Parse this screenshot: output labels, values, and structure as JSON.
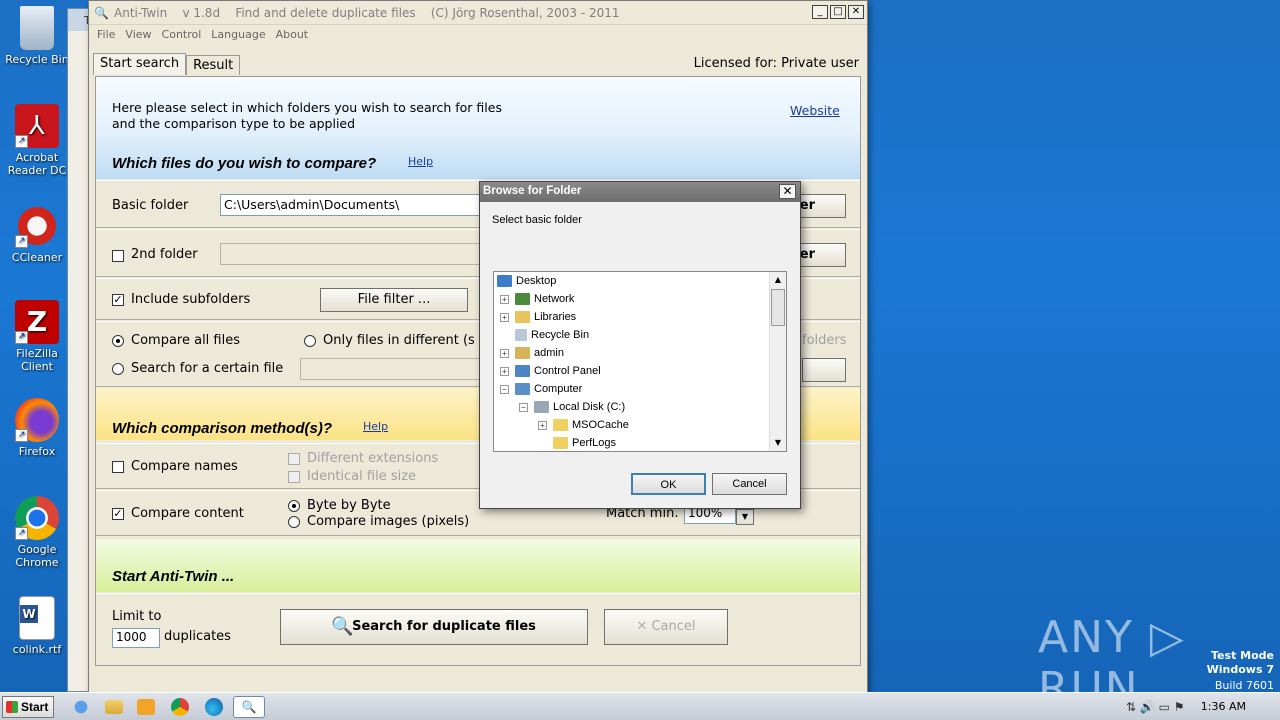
{
  "desktop": {
    "icons": [
      {
        "label": "Recycle Bin",
        "icon": "recycle-bin-icon"
      },
      {
        "label": "Acrobat Reader DC",
        "icon": "acrobat-icon"
      },
      {
        "label": "CCleaner",
        "icon": "ccleaner-icon"
      },
      {
        "label": "FileZilla Client",
        "icon": "filezilla-icon"
      },
      {
        "label": "Firefox",
        "icon": "firefox-icon"
      },
      {
        "label": "Google Chrome",
        "icon": "chrome-icon"
      },
      {
        "label": "colink.rtf",
        "icon": "word-document-icon"
      }
    ],
    "watermark": "ANY ▷ RUN",
    "test_mode": {
      "line1": "Test Mode",
      "line2": "Windows 7",
      "line3": "Build 7601"
    },
    "bg_window_title": "Ti"
  },
  "app": {
    "title": "Anti-Twin    v 1.8d    Find and delete duplicate files    (C) Jörg Rosenthal, 2003 - 2011",
    "menu": [
      "File",
      "View",
      "Control",
      "Language",
      "About"
    ],
    "tabs": [
      {
        "label": "Start search"
      },
      {
        "label": "Result"
      }
    ],
    "licensed": "Licensed for: Private user",
    "intro_line1": "Here please select in which folders you wish to search for files",
    "intro_line2": "and the comparison type to be applied",
    "website": "Website",
    "section1_title": "Which files do you wish to compare?",
    "help": "Help",
    "basic_folder_label": "Basic folder",
    "basic_folder_value": "C:\\Users\\admin\\Documents\\",
    "browse_label": "er",
    "second_folder_label": "2nd folder",
    "include_subfolders": "Include subfolders",
    "file_filter": "File filter ...",
    "compare_all": "Compare all files",
    "only_files_different": "Only files in different (s",
    "folders_suffix": "folders",
    "search_certain": "Search for a certain file",
    "section2_title": "Which comparison method(s)?",
    "compare_names": "Compare names",
    "different_extensions": "Different extensions",
    "identical_size": "Identical file size",
    "compare_content": "Compare content",
    "byte_by_byte": "Byte by Byte",
    "compare_images": "Compare images (pixels)",
    "match_min_label": "Match min.",
    "match_min_value": "100%",
    "section3_title": "Start Anti-Twin ...",
    "limit_to": "Limit to",
    "limit_value": "1000",
    "duplicates": "duplicates",
    "search_button": "Search for duplicate files",
    "cancel_button": "Cancel"
  },
  "dialog": {
    "title": "Browse for Folder",
    "subtitle": "Select basic folder",
    "tree": [
      {
        "label": "Desktop",
        "expander": "",
        "icon": "desktop-icon"
      },
      {
        "label": "Network",
        "expander": "+",
        "icon": "network-icon"
      },
      {
        "label": "Libraries",
        "expander": "+",
        "icon": "libraries-icon"
      },
      {
        "label": "Recycle Bin",
        "expander": "",
        "icon": "recycle-bin-icon"
      },
      {
        "label": "admin",
        "expander": "+",
        "icon": "user-folder-icon"
      },
      {
        "label": "Control Panel",
        "expander": "+",
        "icon": "control-panel-icon"
      },
      {
        "label": "Computer",
        "expander": "−",
        "icon": "computer-icon"
      },
      {
        "label": "Local Disk (C:)",
        "expander": "−",
        "icon": "drive-icon"
      },
      {
        "label": "MSOCache",
        "expander": "+",
        "icon": "folder-icon"
      },
      {
        "label": "PerfLogs",
        "expander": "",
        "icon": "folder-icon"
      }
    ],
    "ok": "OK",
    "cancel": "Cancel"
  },
  "taskbar": {
    "start": "Start",
    "clock": "1:36 AM"
  }
}
